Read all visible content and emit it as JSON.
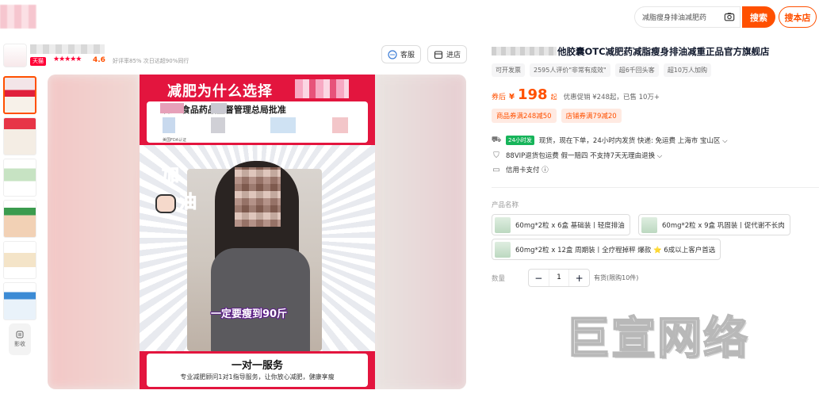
{
  "header": {
    "search_placeholder": "减脂瘦身排油减肥药",
    "search_button": "搜索",
    "shop_search_button": "搜本店"
  },
  "store": {
    "badge": "天猫",
    "stars": "★★★★★",
    "rating": "4.6",
    "meta": "好评率85%   次日达超90%同行",
    "service_button": "客服",
    "enter_button": "进店"
  },
  "thumbnails": {
    "more_label": "影收"
  },
  "poster": {
    "title": "减肥为什么选择",
    "cert_text": "认证    食品药品监督管理总局批准",
    "cert_small": "美国FDA认证",
    "jia": "加",
    "you": "油",
    "caption": "一定要瘦到90斤",
    "service_title": "一对一服务",
    "service_sub": "专业减肥顾问1对1指导服务，让你放心减肥，健康享瘦"
  },
  "product": {
    "title": "他胶囊OTC减肥药减脂瘦身排油减重正品官方旗舰店",
    "tags": [
      "可开发票",
      "2595人评价\"非常有成效\"",
      "超6千回头客",
      "超10万人加购"
    ],
    "price_prefix": "券后",
    "price_currency": "¥",
    "price_value": "198",
    "price_suffix": "起",
    "price_info": "优惠促销 ¥248起，已售 10万+",
    "coupons": [
      "商品券满248减50",
      "店铺券满79减20"
    ],
    "delivery_tag": "24小时发",
    "delivery_text": "现货，现在下单，24小时内发货  快递: 免运费  上海市 宝山区 ⌵",
    "service_text": "88VIP退货包运费   假一赔四   不支持7天无理由退换 ⌵",
    "pay_text": "信用卡支付  ⓘ",
    "sku_label": "产品名称",
    "skus": [
      "60mg*2粒 x 6盒 基础装丨轻度排油",
      "60mg*2粒 x 9盒 巩固装丨促代谢不长肉",
      "60mg*2粒 x 12盒 周期装丨全疗程掉秤 爆款 ⭐ 6成以上客户首选"
    ],
    "qty_label": "数量",
    "qty_value": "1",
    "stock_text": "有货(限购10件)"
  },
  "watermark": "巨宣网络"
}
